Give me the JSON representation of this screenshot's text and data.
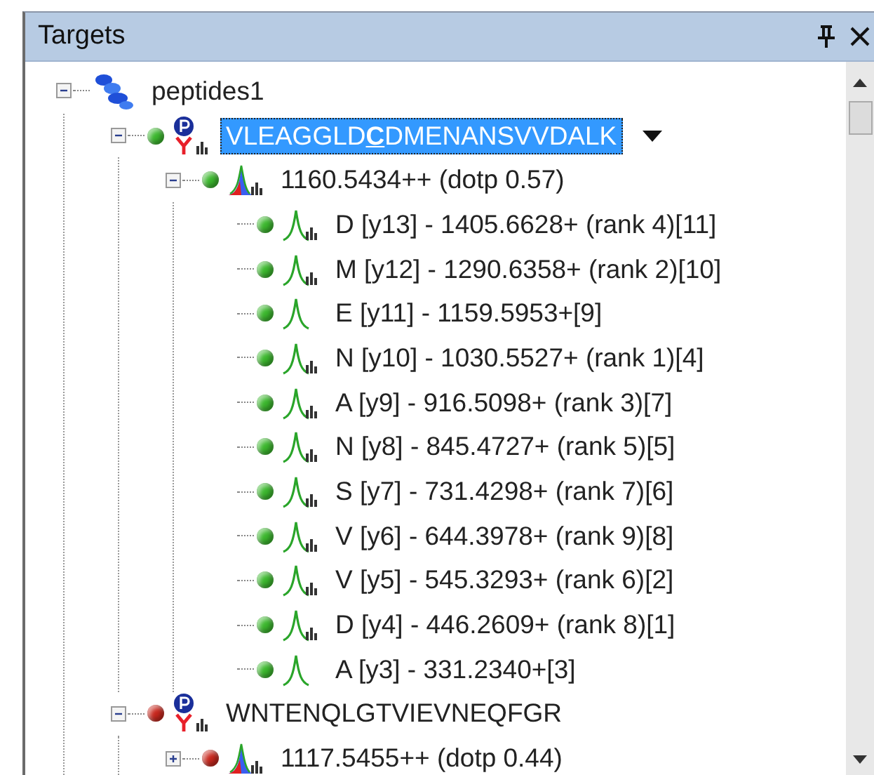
{
  "panel": {
    "title": "Targets"
  },
  "tree": [
    {
      "kind": "peptide_list",
      "label": "peptides1",
      "expanded": true,
      "selected": false,
      "children": [
        {
          "kind": "peptide",
          "label": "VLEAGGLD**C**DMENANSVVDALK",
          "expanded": true,
          "selected": true,
          "color": "#3cb82e",
          "children": [
            {
              "kind": "precursor",
              "label": "1160.5434++ (dotp 0.57)",
              "expanded": true,
              "selected": false,
              "color": "#3cb82e",
              "children": [
                {
                  "kind": "transition",
                  "label": "D [y13] - 1405.6628+ (rank 4)[11]",
                  "has_spectrum": true,
                  "selected": false,
                  "color": "#3cb82e"
                },
                {
                  "kind": "transition",
                  "label": "M [y12] - 1290.6358+ (rank 2)[10]",
                  "has_spectrum": true,
                  "selected": false,
                  "color": "#3cb82e"
                },
                {
                  "kind": "transition",
                  "label": "E [y11] - 1159.5953+[9]",
                  "has_spectrum": false,
                  "selected": false,
                  "color": "#3cb82e"
                },
                {
                  "kind": "transition",
                  "label": "N [y10] - 1030.5527+ (rank 1)[4]",
                  "has_spectrum": true,
                  "selected": false,
                  "color": "#3cb82e"
                },
                {
                  "kind": "transition",
                  "label": "A [y9] - 916.5098+ (rank 3)[7]",
                  "has_spectrum": true,
                  "selected": false,
                  "color": "#3cb82e"
                },
                {
                  "kind": "transition",
                  "label": "N [y8] - 845.4727+ (rank 5)[5]",
                  "has_spectrum": true,
                  "selected": false,
                  "color": "#3cb82e"
                },
                {
                  "kind": "transition",
                  "label": "S [y7] - 731.4298+ (rank 7)[6]",
                  "has_spectrum": true,
                  "selected": false,
                  "color": "#3cb82e"
                },
                {
                  "kind": "transition",
                  "label": "V [y6] - 644.3978+ (rank 9)[8]",
                  "has_spectrum": true,
                  "selected": false,
                  "color": "#3cb82e"
                },
                {
                  "kind": "transition",
                  "label": "V [y5] - 545.3293+ (rank 6)[2]",
                  "has_spectrum": true,
                  "selected": false,
                  "color": "#3cb82e"
                },
                {
                  "kind": "transition",
                  "label": "D [y4] - 446.2609+ (rank 8)[1]",
                  "has_spectrum": true,
                  "selected": false,
                  "color": "#3cb82e"
                },
                {
                  "kind": "transition",
                  "label": "A [y3] - 331.2340+[3]",
                  "has_spectrum": false,
                  "selected": false,
                  "color": "#3cb82e"
                }
              ]
            }
          ]
        },
        {
          "kind": "peptide",
          "label": "WNTENQLGTVIEVNEQFGR",
          "expanded": true,
          "selected": false,
          "color": "#c8281e",
          "children": [
            {
              "kind": "precursor",
              "label": "1117.5455++ (dotp 0.44)",
              "expanded": false,
              "selected": false,
              "color": "#c8281e"
            }
          ]
        }
      ]
    }
  ]
}
